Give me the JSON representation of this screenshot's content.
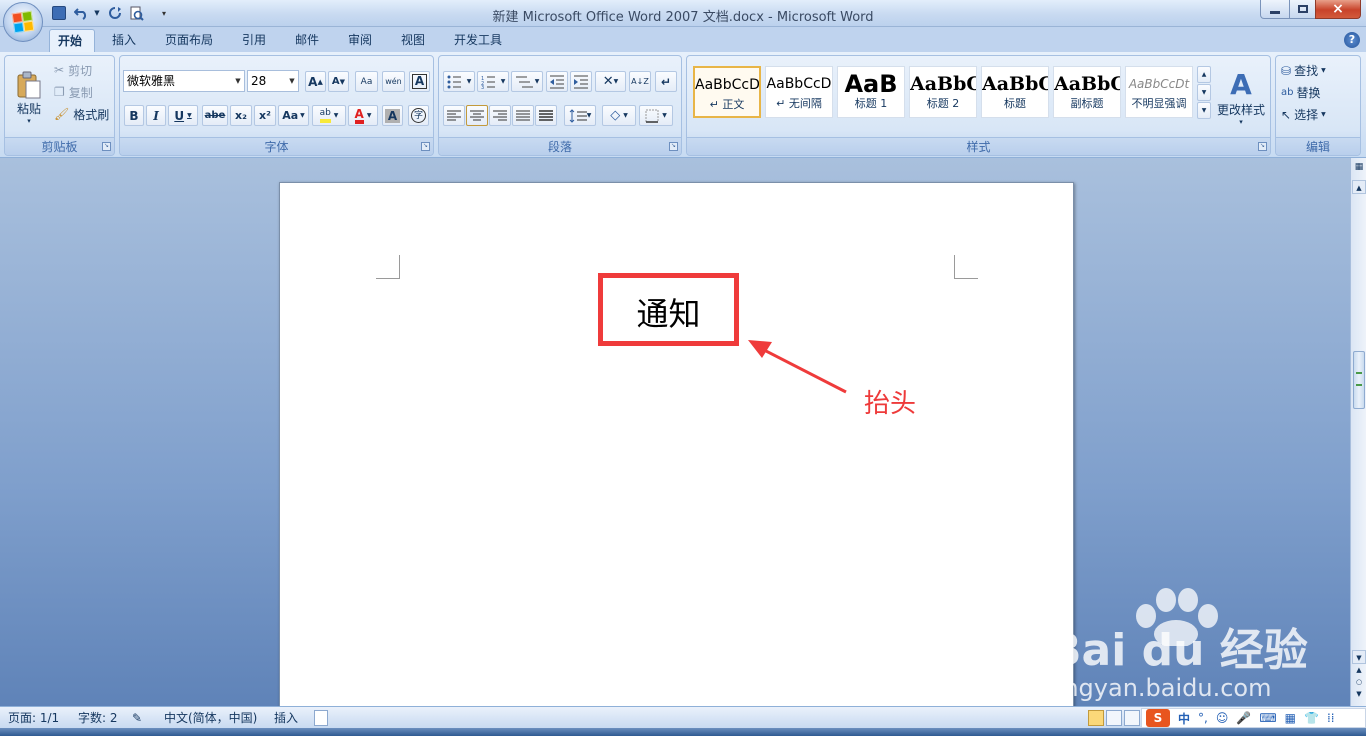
{
  "window": {
    "title": "新建 Microsoft Office Word 2007 文档.docx - Microsoft Word",
    "controls": {
      "minimize": "–",
      "maximize": "□",
      "close": "×"
    }
  },
  "tabs": [
    "开始",
    "插入",
    "页面布局",
    "引用",
    "邮件",
    "审阅",
    "视图",
    "开发工具"
  ],
  "active_tab": "开始",
  "clipboard": {
    "paste": "粘贴",
    "cut": "剪切",
    "copy": "复制",
    "format_painter": "格式刷",
    "group_label": "剪贴板"
  },
  "font": {
    "family": "微软雅黑",
    "size": "28",
    "grow": "A",
    "shrink": "A",
    "clear": "Aa",
    "phonetic": "wén",
    "border": "A",
    "bold": "B",
    "italic": "I",
    "underline": "U",
    "strike": "abe",
    "subscript": "x₂",
    "superscript": "x²",
    "change_case": "Aa",
    "highlight": "ab",
    "font_color": "A",
    "shade": "A",
    "enclose": "字",
    "group_label": "字体"
  },
  "paragraph": {
    "group_label": "段落",
    "sort": "A↓Z",
    "marks": "↵"
  },
  "styles": {
    "items": [
      {
        "sample": "AaBbCcD",
        "name": "↵ 正文"
      },
      {
        "sample": "AaBbCcD",
        "name": "↵ 无间隔"
      },
      {
        "sample": "AaB",
        "name": "标题 1"
      },
      {
        "sample": "AaBbC",
        "name": "标题 2"
      },
      {
        "sample": "AaBbC",
        "name": "标题"
      },
      {
        "sample": "AaBbC",
        "name": "副标题"
      },
      {
        "sample": "AaBbCcDt",
        "name": "不明显强调"
      }
    ],
    "change_styles": "更改样式",
    "group_label": "样式"
  },
  "editing": {
    "find": "查找",
    "replace": "替换",
    "select": "选择",
    "group_label": "编辑"
  },
  "document": {
    "heading": "通知",
    "annotation": "抬头"
  },
  "status": {
    "page": "页面: 1/1",
    "words": "字数: 2",
    "language": "中文(简体，中国)",
    "mode": "插入"
  },
  "ime": {
    "logo": "S",
    "lang": "中"
  },
  "watermark": {
    "brand": "Bai du 经验",
    "url": "jingyan.baidu.com"
  },
  "colors": {
    "accent_red": "#ef3b3b",
    "highlight_yellow": "#f7e93a",
    "font_red": "#e02020"
  }
}
